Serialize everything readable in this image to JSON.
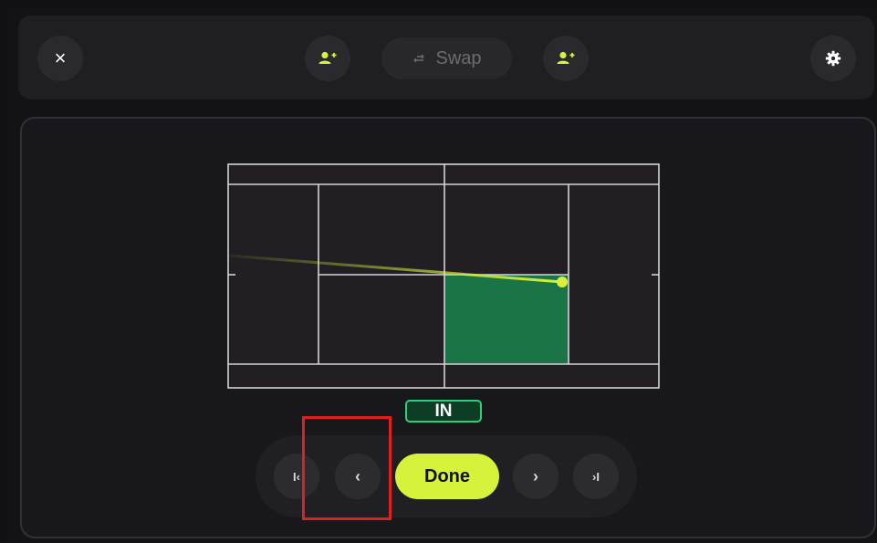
{
  "topbar": {
    "close_label": "×",
    "swap_label": "Swap",
    "swap_icon": "swap-icon",
    "add_player_icon": "add-player-icon",
    "settings_icon": "gear-icon"
  },
  "court": {
    "result_label": "IN",
    "ball_color": "#d7f23a",
    "highlight_zone_color": "#1a7446"
  },
  "nav": {
    "first_label": "I‹",
    "prev_label": "‹",
    "done_label": "Done",
    "next_label": "›",
    "last_label": "›I"
  },
  "colors": {
    "accent": "#d7f23a",
    "in_border": "#2bd07a",
    "annotation_box": "#e0201f"
  }
}
